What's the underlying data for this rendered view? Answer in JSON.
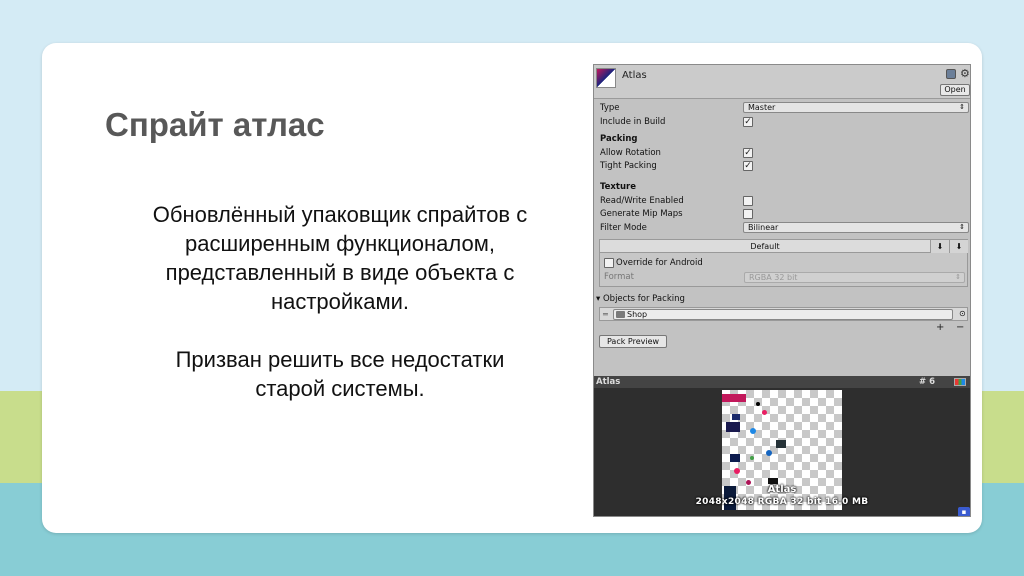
{
  "slide": {
    "title": "Спрайт атлас",
    "paragraph1": [
      "Обновлённый упаковщик спрайтов с",
      "расширенным функционалом,",
      "представленный в виде объекта с",
      "настройками."
    ],
    "paragraph2": [
      "Призван решить все недостатки",
      "старой системы."
    ]
  },
  "colors": {
    "background": "#d4ebf5",
    "band_green": "#c8dd8c",
    "band_teal": "#88cdd5",
    "card": "#ffffff",
    "title_text": "#585858"
  },
  "inspector": {
    "asset_name": "Atlas",
    "open_button": "Open",
    "header_icons": [
      "book-icon",
      "gear-icon"
    ],
    "type_label": "Type",
    "type_value": "Master",
    "include_in_build_label": "Include in Build",
    "include_in_build": true,
    "packing_header": "Packing",
    "allow_rotation_label": "Allow Rotation",
    "allow_rotation": true,
    "tight_packing_label": "Tight Packing",
    "tight_packing": true,
    "texture_header": "Texture",
    "read_write_label": "Read/Write Enabled",
    "read_write": false,
    "mipmaps_label": "Generate Mip Maps",
    "mipmaps": false,
    "filter_mode_label": "Filter Mode",
    "filter_mode_value": "Bilinear",
    "platform_tab": "Default",
    "override_android_label": "Override for Android",
    "override_android": false,
    "format_label": "Format",
    "format_value": "RGBA 32 bit",
    "objects_header": "Objects for Packing",
    "objects": [
      "Shop"
    ],
    "add_button": "+",
    "remove_button": "−",
    "pack_preview_button": "Pack Preview"
  },
  "preview": {
    "title": "Atlas",
    "page_count": "# 6",
    "atlas_label": "Atlas",
    "atlas_info": "2048x2048 RGBA 32 bit   16.0 MB"
  }
}
